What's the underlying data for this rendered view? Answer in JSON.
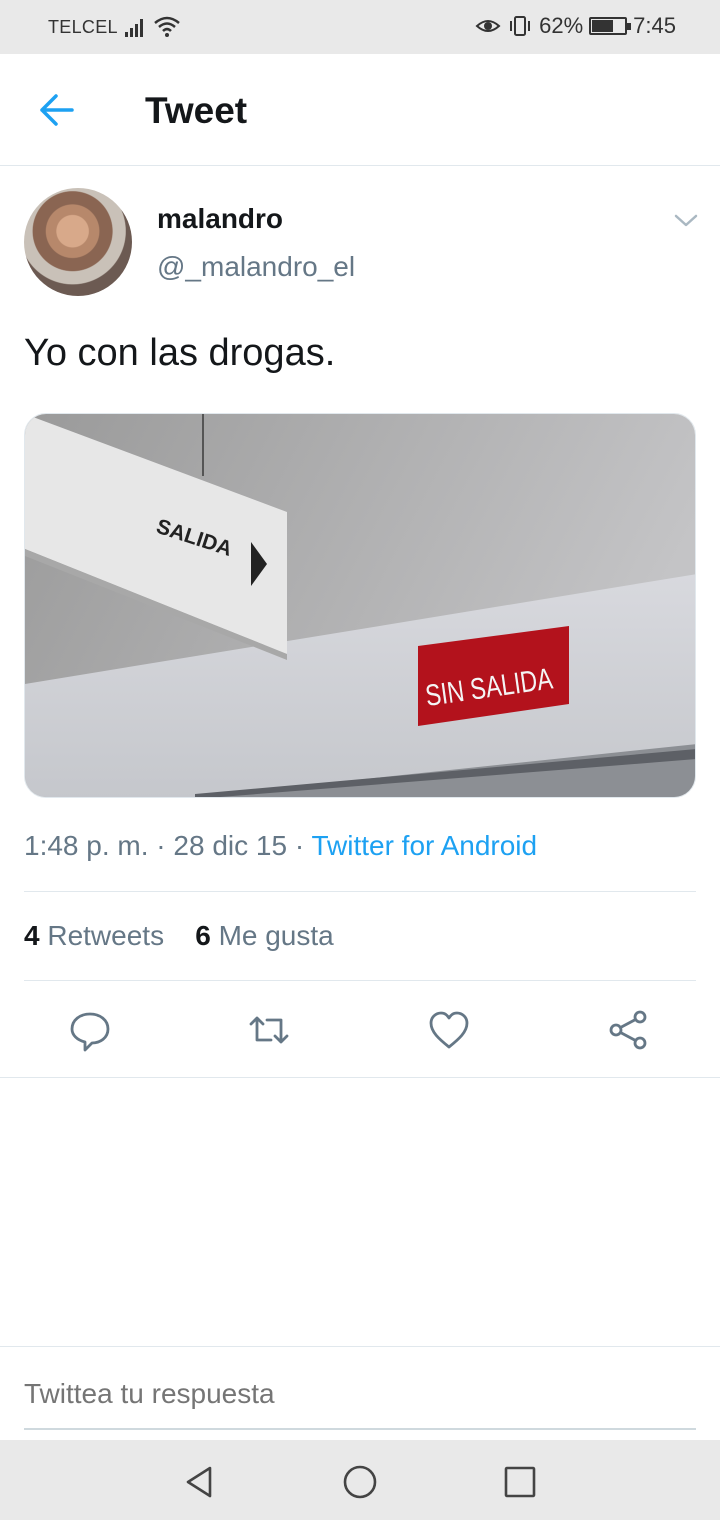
{
  "status_bar": {
    "carrier": "TELCEL",
    "battery_percent": "62%",
    "battery_level": 0.62,
    "time": "7:45"
  },
  "header": {
    "title": "Tweet"
  },
  "tweet": {
    "author_name": "malandro",
    "author_handle": "@_malandro_el",
    "text": "Yo con las drogas.",
    "media": {
      "sign_left": "SALIDA",
      "sign_right": "SIN SALIDA"
    },
    "time": "1:48 p. m.",
    "date": "28 dic 15",
    "source": "Twitter for Android",
    "retweets_count": "4",
    "retweets_label": "Retweets",
    "likes_count": "6",
    "likes_label": "Me gusta"
  },
  "reply": {
    "placeholder": "Twittea tu respuesta"
  },
  "colors": {
    "accent": "#1da1f2",
    "text_primary": "#14171a",
    "text_secondary": "#657786",
    "sign_red": "#b3121c"
  },
  "icons": {
    "back": "arrow-left-icon",
    "menu": "chevron-down-icon",
    "reply": "comment-icon",
    "retweet": "retweet-icon",
    "like": "heart-icon",
    "share": "share-icon"
  }
}
